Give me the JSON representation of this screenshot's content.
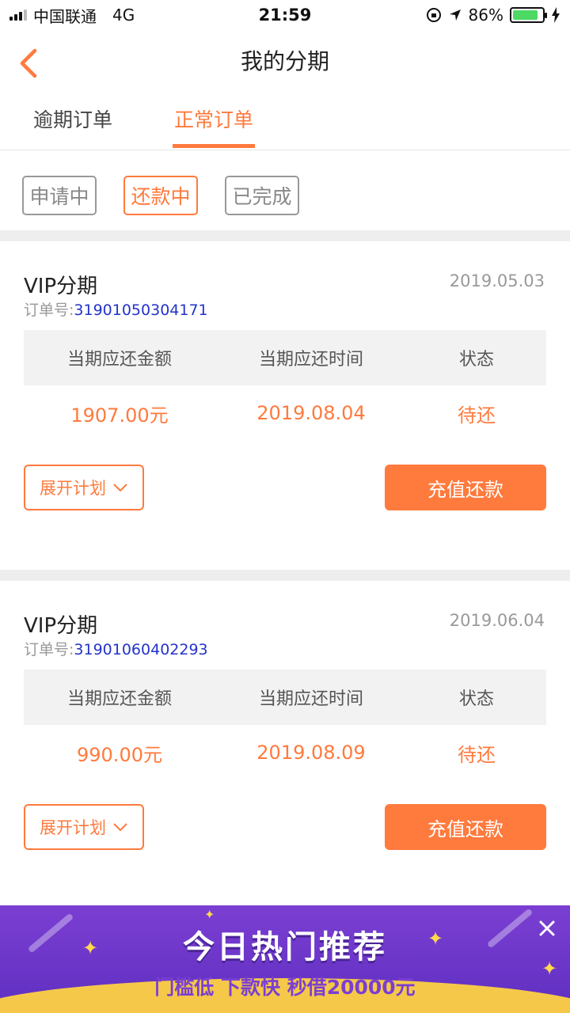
{
  "status_bar": {
    "carrier": "中国联通",
    "network": "4G",
    "time": "21:59",
    "battery_percent": "86%",
    "battery_level": 0.86,
    "battery_color": "#4cd964"
  },
  "nav": {
    "back_icon": "chevron-left-icon",
    "title": "我的分期"
  },
  "tabs": [
    {
      "label": "逾期订单",
      "active": false
    },
    {
      "label": "正常订单",
      "active": true
    }
  ],
  "filters": [
    {
      "label": "申请中",
      "active": false
    },
    {
      "label": "还款中",
      "active": true
    },
    {
      "label": "已完成",
      "active": false
    }
  ],
  "table_headers": [
    "当期应还金额",
    "当期应还时间",
    "状态"
  ],
  "order_label": "订单号:",
  "expand_label": "展开计划",
  "pay_label": "充值还款",
  "orders": [
    {
      "title": "VIP分期",
      "date": "2019.05.03",
      "order_no": "31901050304171",
      "amount": "1907.00元",
      "due_date": "2019.08.04",
      "status": "待还"
    },
    {
      "title": "VIP分期",
      "date": "2019.06.04",
      "order_no": "31901060402293",
      "amount": "990.00元",
      "due_date": "2019.08.09",
      "status": "待还"
    }
  ],
  "banner": {
    "title": "今日热门推荐",
    "subtitle": "门槛低 下款快 秒借20000元",
    "close_icon": "close-icon"
  },
  "colors": {
    "accent": "#ff7a3d",
    "order_no": "#2433c9",
    "banner_purple": "#7b3fd2"
  }
}
